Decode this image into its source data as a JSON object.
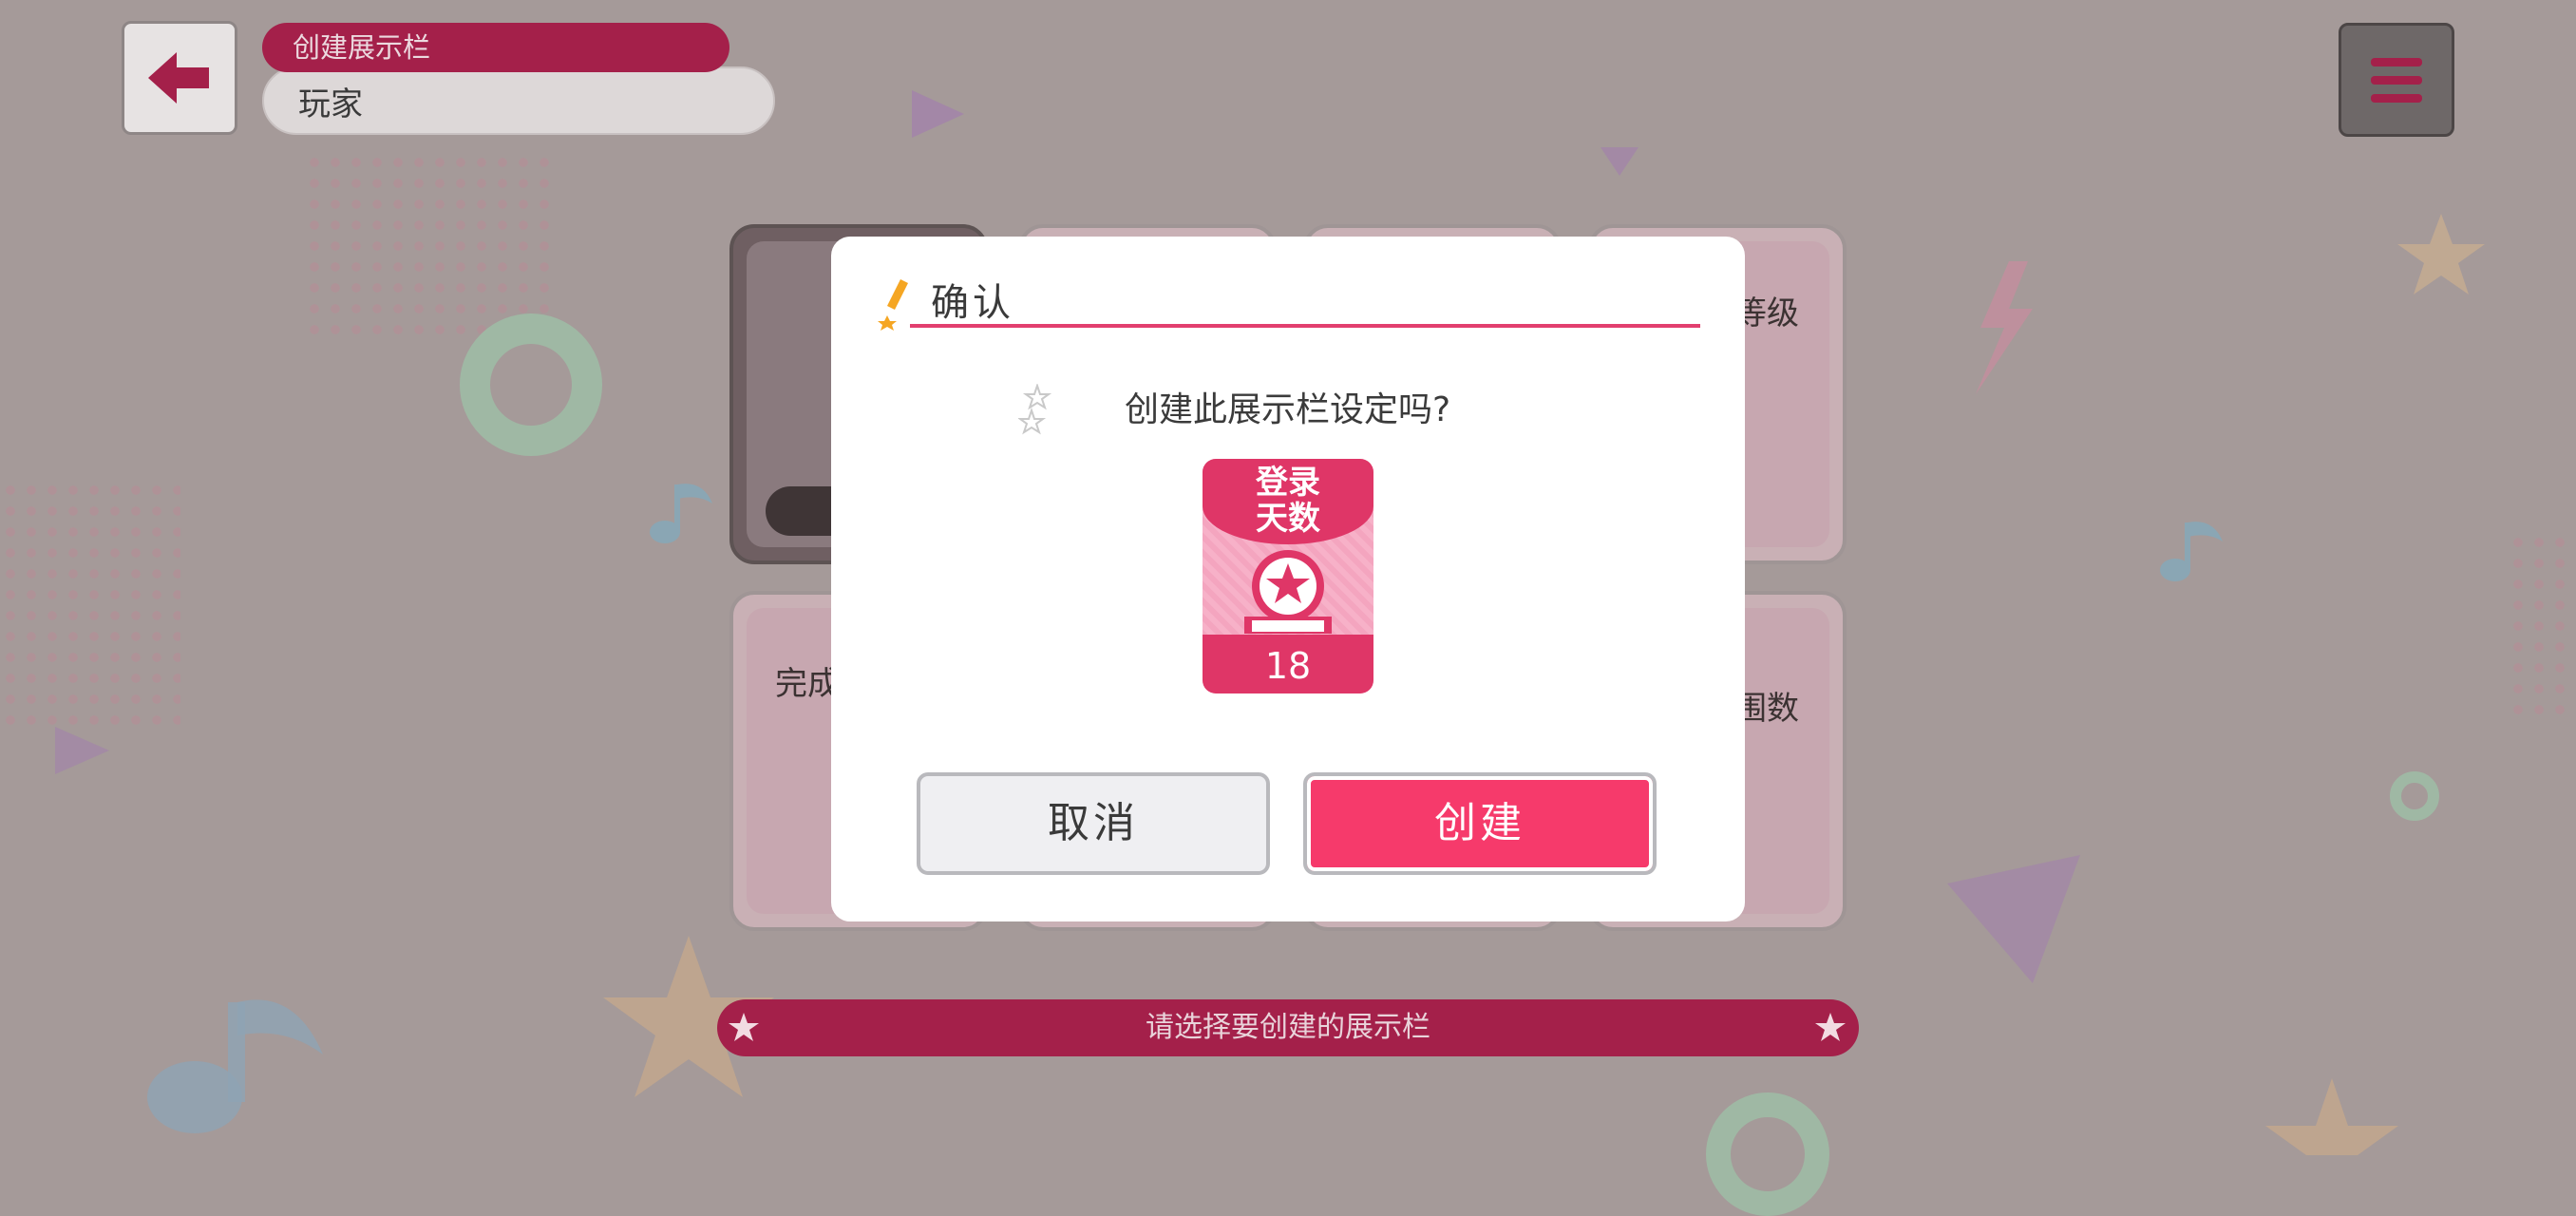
{
  "header": {
    "title": "创建展示栏",
    "subtitle": "玩家"
  },
  "cards": {
    "row1_right_label": "等级",
    "row2_left_label": "完成",
    "row2_right_label_line1": "I",
    "row2_right_label_line2": "围数"
  },
  "hint": "请选择要创建的展示栏",
  "dialog": {
    "title": "确认",
    "question": "创建此展示栏设定吗?",
    "badge": {
      "label_line1": "登录",
      "label_line2": "天数",
      "value": "18"
    },
    "cancel_label": "取消",
    "create_label": "创建"
  },
  "colors": {
    "accent": "#a4204a",
    "dialog_accent": "#e23f6f",
    "create_button": "#f63a6b",
    "backdrop": "#a59a99"
  }
}
